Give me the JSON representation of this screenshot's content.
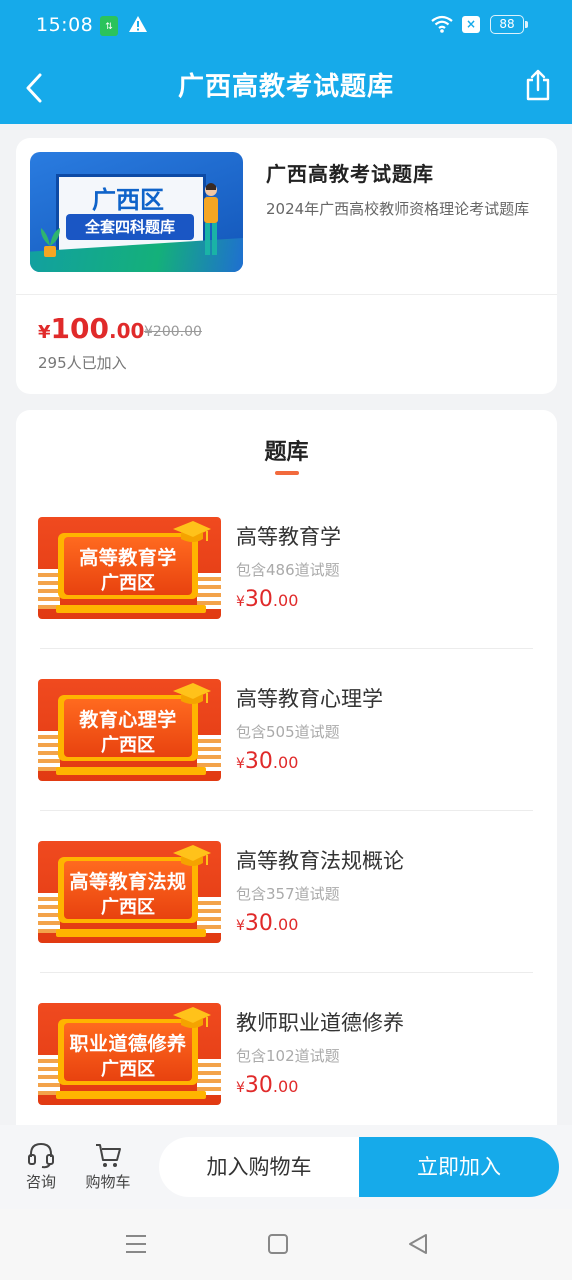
{
  "status": {
    "time": "15:08",
    "battery": "88",
    "sim_label": "⇅"
  },
  "nav": {
    "title": "广西高教考试题库"
  },
  "product": {
    "cover_line1": "广西区",
    "cover_line2": "全套四科题库",
    "title": "广西高教考试题库",
    "description": "2024年广西高校教师资格理论考试题库",
    "price_symbol": "¥",
    "price_int": "100",
    "price_dec": ".00",
    "old_price": "¥200.00",
    "joined": "295人已加入"
  },
  "section": {
    "title": "题库"
  },
  "items": [
    {
      "thumb_line1": "高等教育学",
      "thumb_line2": "广西区",
      "name": "高等教育学",
      "count": "包含486道试题",
      "price_symbol": "¥",
      "price_int": "30",
      "price_dec": ".00"
    },
    {
      "thumb_line1": "教育心理学",
      "thumb_line2": "广西区",
      "name": "高等教育心理学",
      "count": "包含505道试题",
      "price_symbol": "¥",
      "price_int": "30",
      "price_dec": ".00"
    },
    {
      "thumb_line1": "高等教育法规",
      "thumb_line2": "广西区",
      "name": "高等教育法规概论",
      "count": "包含357道试题",
      "price_symbol": "¥",
      "price_int": "30",
      "price_dec": ".00"
    },
    {
      "thumb_line1": "职业道德修养",
      "thumb_line2": "广西区",
      "name": "教师职业道德修养",
      "count": "包含102道试题",
      "price_symbol": "¥",
      "price_int": "30",
      "price_dec": ".00"
    }
  ],
  "bottom": {
    "consult_label": "咨询",
    "cart_label": "购物车",
    "add_cart_label": "加入购物车",
    "join_label": "立即加入"
  },
  "colors": {
    "primary": "#16aaea",
    "price": "#e02a2a",
    "accent": "#f26a3d"
  },
  "icons": [
    "back-arrow-icon",
    "share-icon",
    "headset-icon",
    "cart-icon",
    "menu-icon",
    "home-icon",
    "back-triangle-icon",
    "wifi-icon",
    "warning-icon"
  ]
}
